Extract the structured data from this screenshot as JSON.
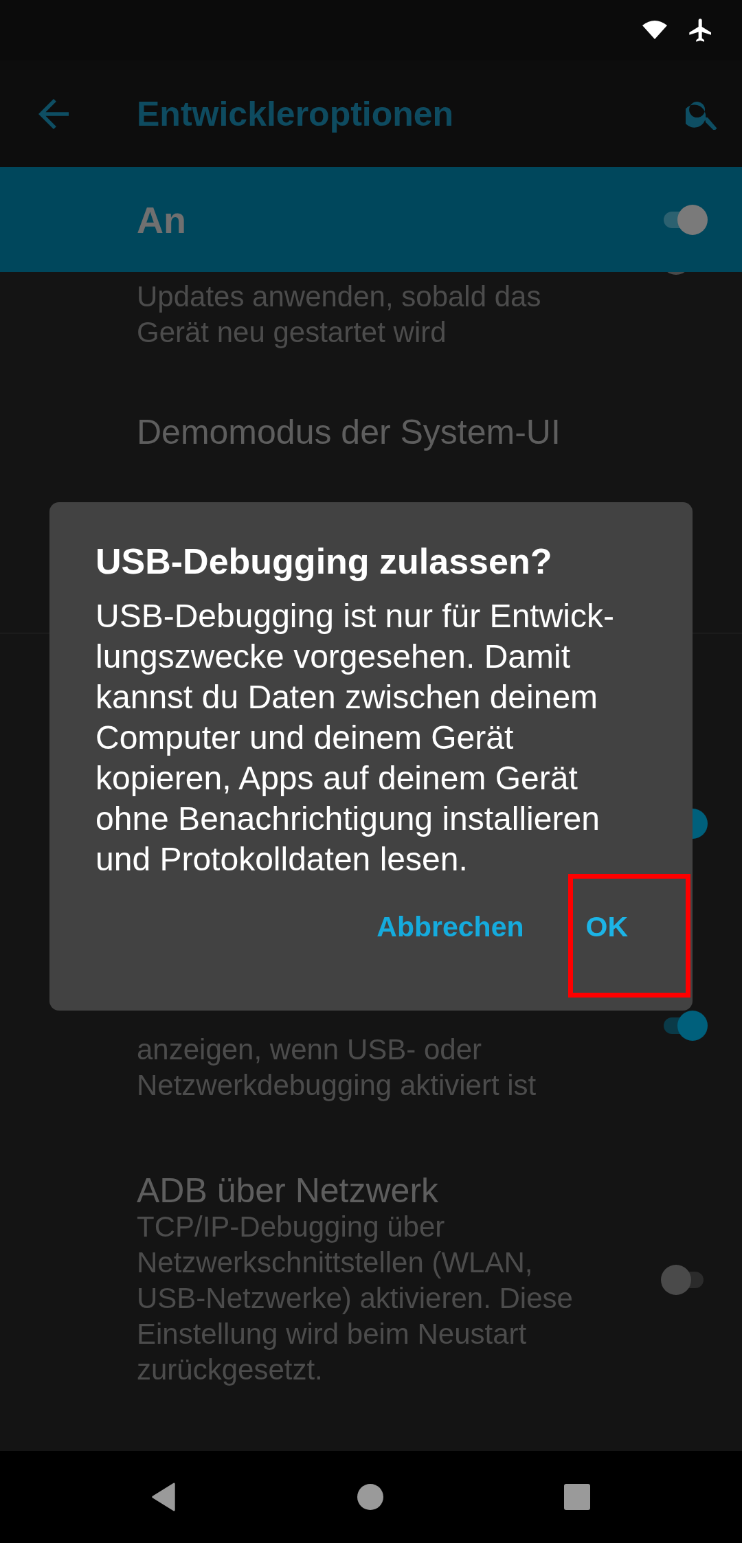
{
  "app_bar": {
    "title": "Entwickleroptionen"
  },
  "master_switch": {
    "label": "An",
    "on": true
  },
  "settings": [
    {
      "kind": "switch",
      "summary_lines": [
        "Updates anwenden, sobald das",
        "Gerät neu gestartet wird"
      ],
      "on": false
    },
    {
      "kind": "plain",
      "title": "Demomodus der System-UI"
    },
    {
      "kind": "switch",
      "on": true
    },
    {
      "kind": "switch",
      "summary_lines": [
        "anzeigen, wenn USB- oder",
        "Netzwerkdebugging aktiviert ist"
      ],
      "on": true
    },
    {
      "kind": "switch",
      "title": "ADB über Netzwerk",
      "summary_lines": [
        "TCP/IP-Debugging über",
        "Netzwerkschnittstellen (WLAN,",
        "USB-Netzwerke) aktivieren. Diese",
        "Einstellung wird beim Neustart",
        "zurückgesetzt."
      ],
      "on": false
    }
  ],
  "dialog": {
    "title": "USB-Debugging zulassen?",
    "body_lines": [
      "USB-Debugging ist nur für Entwick-",
      "lungszwecke vorgesehen. Damit",
      "kannst du Daten zwischen deinem",
      "Computer und deinem Gerät",
      "kopieren, Apps auf deinem Gerät",
      "ohne Benachrichtigung installieren",
      "und Protokolldaten lesen."
    ],
    "buttons": [
      {
        "label": "Abbrechen",
        "highlighted": false
      },
      {
        "label": "OK",
        "highlighted": true
      }
    ]
  }
}
